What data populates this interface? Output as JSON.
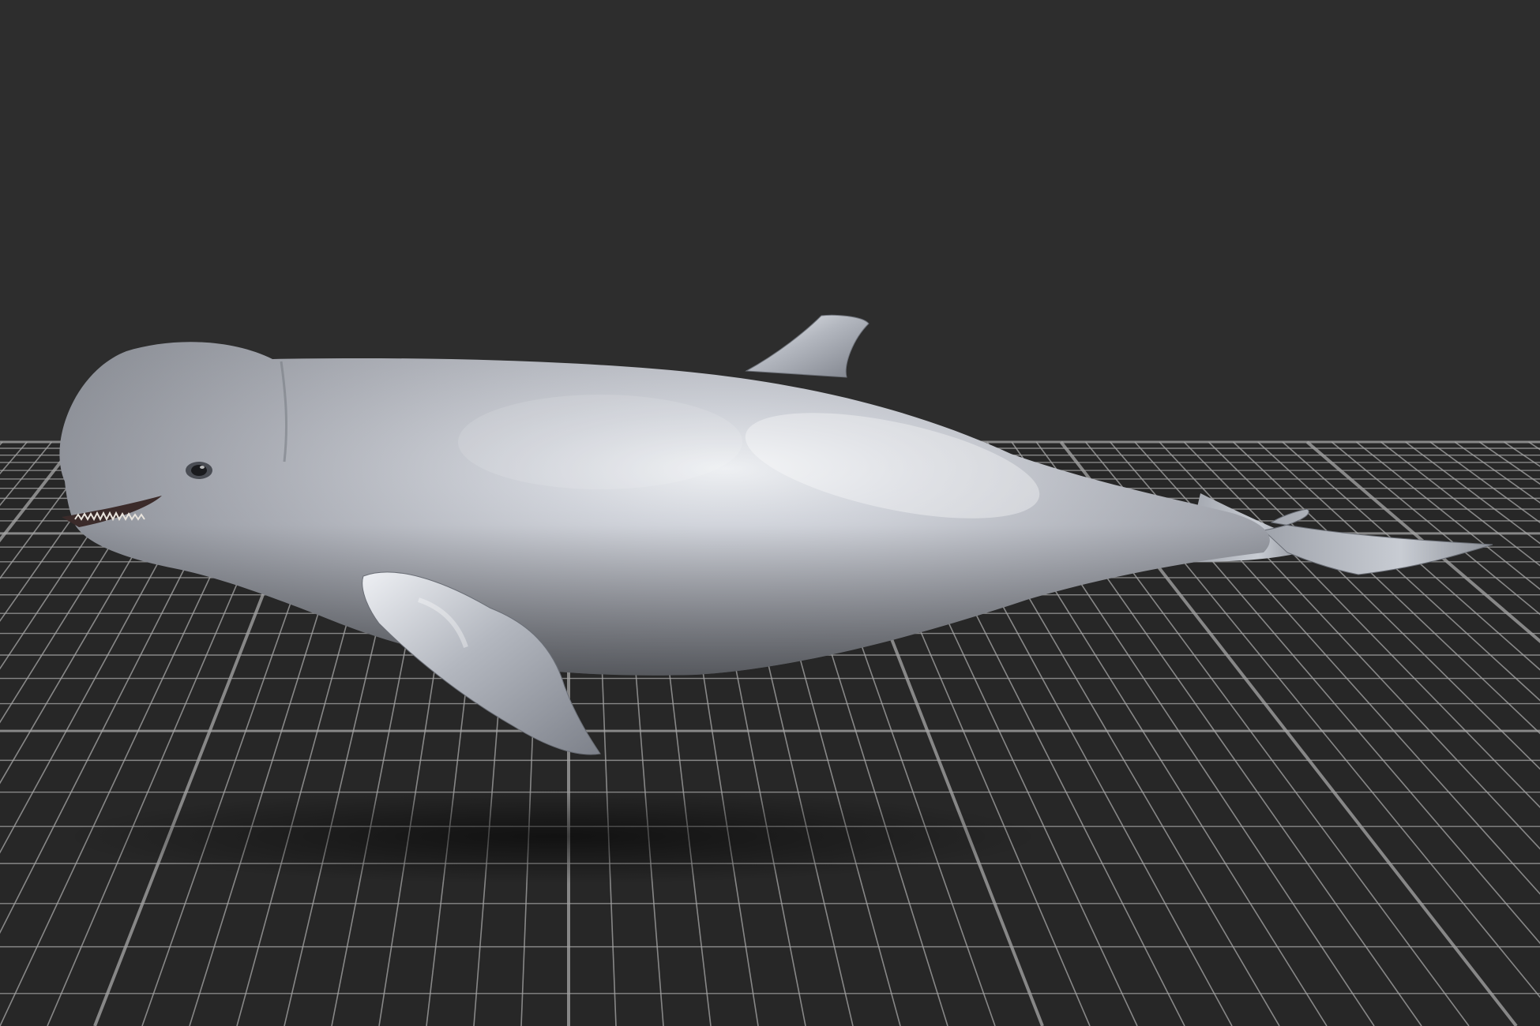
{
  "scene": {
    "background_color": "#2d2d2d",
    "grid": {
      "visible": true,
      "line_color": "#a8a8a8",
      "floor_color": "#272727"
    },
    "model": {
      "subject": "whale",
      "material_color": "#b8bcc4",
      "highlight_color": "#f2f4f7",
      "shadow_color": "#6f737b",
      "mouth_color": "#3b2b2a"
    }
  }
}
